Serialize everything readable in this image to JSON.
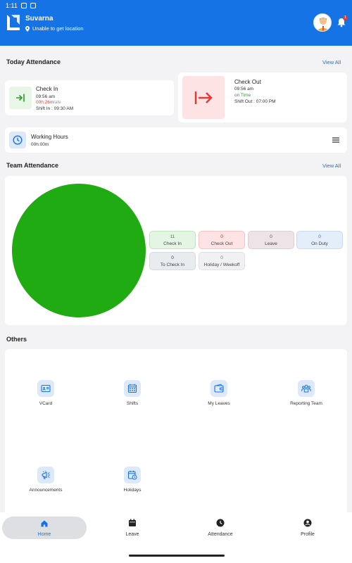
{
  "status": {
    "time": "1:11"
  },
  "header": {
    "user_name": "Suvarna",
    "location_text": "Unable to get location",
    "notification_count": "1"
  },
  "today": {
    "title": "Today Attendance",
    "view_all": "View All"
  },
  "check_in": {
    "title": "Check In",
    "time": "09:56 am",
    "late": "00h:26m",
    "late_suffix": "late",
    "shift": "Shift In : 09:30 AM"
  },
  "check_out": {
    "title": "Check Out",
    "time": "09:56 am",
    "status": "on Time",
    "shift": "Shift Out : 07:00 PM"
  },
  "working_hours": {
    "title": "Working Hours",
    "value": "00h:00m"
  },
  "team": {
    "title": "Team Attendance",
    "view_all": "View All",
    "stats": [
      {
        "num": "11",
        "label": "Check In",
        "bg": "#e5f5e4",
        "border": "#bfe6bc",
        "numColor": "#2e7d32"
      },
      {
        "num": "0",
        "label": "Check Out",
        "bg": "#fde3e3",
        "border": "#f5c4c4",
        "numColor": "#c62828"
      },
      {
        "num": "0",
        "label": "Leave",
        "bg": "#eee3e6",
        "border": "#e0cdd2",
        "numColor": "#555555"
      },
      {
        "num": "0",
        "label": "On Duty",
        "bg": "#e3eefa",
        "border": "#c8dcf3",
        "numColor": "#1673e6"
      },
      {
        "num": "0",
        "label": "To Check In",
        "bg": "#e8ecef",
        "border": "#d6dbe0",
        "numColor": "#333333"
      },
      {
        "num": "0",
        "label": "Holiday / Weekoff",
        "bg": "#f1f1f3",
        "border": "#e2e2e6",
        "numColor": "#777777"
      }
    ],
    "pie_color": "#20ab13"
  },
  "others": {
    "title": "Others",
    "tiles": [
      {
        "label": "VCard",
        "icon": "id-card-icon"
      },
      {
        "label": "Shifts",
        "icon": "calendar-grid-icon"
      },
      {
        "label": "My Leaves",
        "icon": "wallet-icon"
      },
      {
        "label": "Reporting Team",
        "icon": "team-icon"
      },
      {
        "label": "Announcements",
        "icon": "megaphone-icon"
      },
      {
        "label": "Holidays",
        "icon": "holiday-calendar-icon"
      }
    ]
  },
  "nav": {
    "home": "Home",
    "leave": "Leave",
    "attendance": "Attendance",
    "profile": "Profile"
  },
  "colors": {
    "primary": "#1673e6",
    "late": "#e53935",
    "on_time": "#2e9a2e",
    "checkout_arrow": "#e53935"
  }
}
